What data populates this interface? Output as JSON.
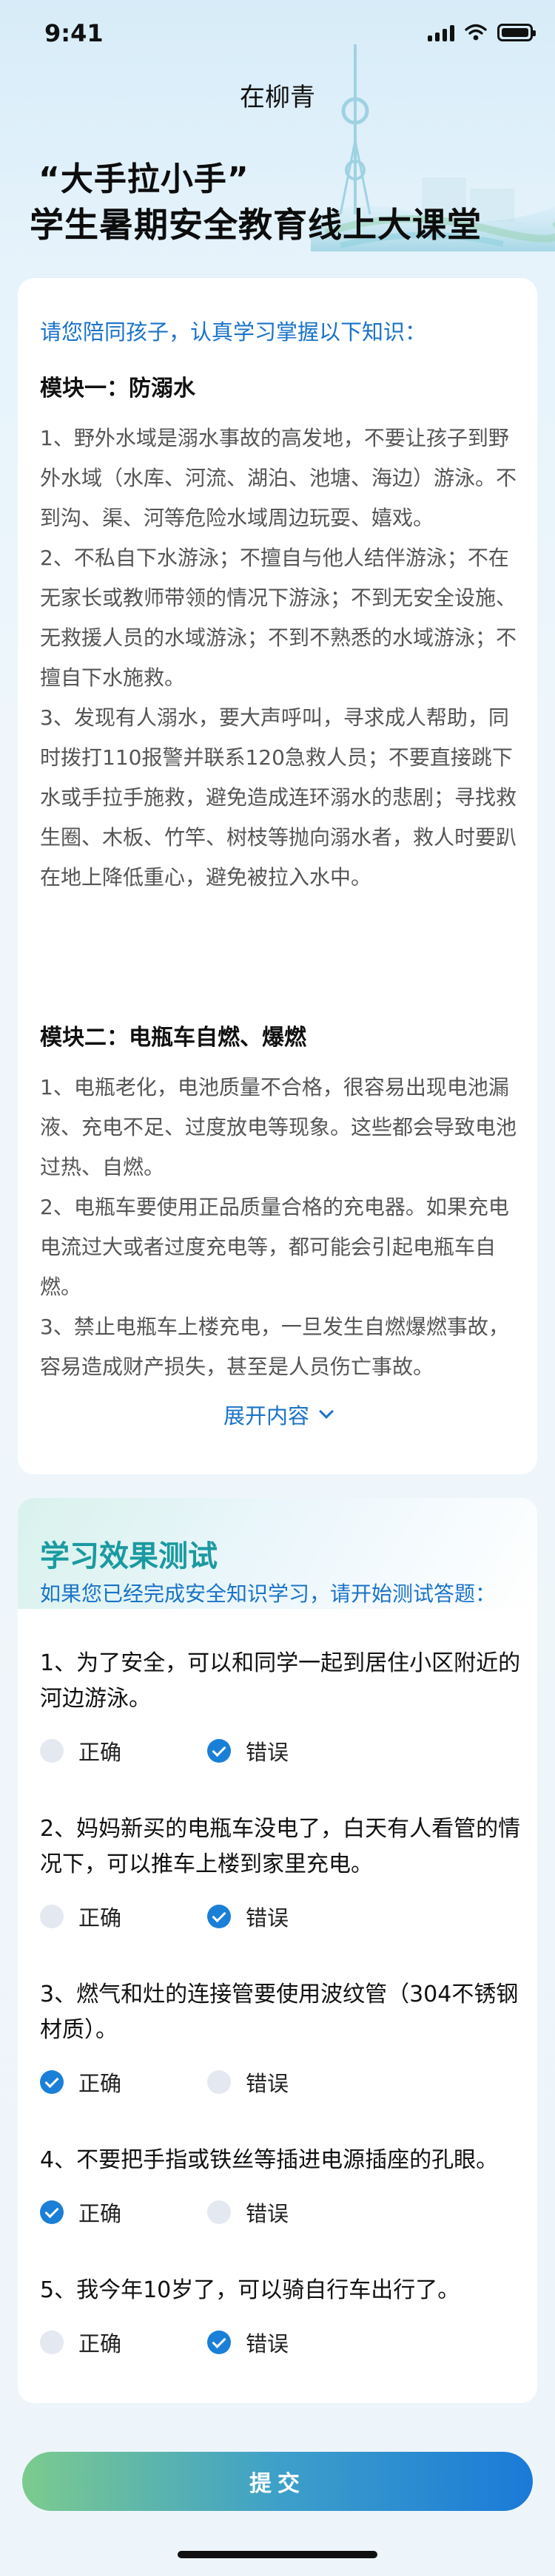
{
  "status_bar": {
    "time": "9:41"
  },
  "nav": {
    "title": "在柳青"
  },
  "hero": {
    "line1": "“大手拉小手”",
    "line2": "学生暑期安全教育线上大课堂"
  },
  "knowledge": {
    "intro": "请您陪同孩子，认真学习掌握以下知识：",
    "modules": [
      {
        "title": "模块一：防溺水",
        "paragraphs": [
          "1、野外水域是溺水事故的高发地，不要让孩子到野外水域（水库、河流、湖泊、池塘、海边）游泳。不到沟、渠、河等危险水域周边玩耍、嬉戏。",
          "2、不私自下水游泳；不擅自与他人结伴游泳；不在无家长或教师带领的情况下游泳；不到无安全设施、无救援人员的水域游泳；不到不熟悉的水域游泳；不擅自下水施救。",
          "3、发现有人溺水，要大声呼叫，寻求成人帮助，同时拨打110报警并联系120急救人员；不要直接跳下水或手拉手施救，避免造成连环溺水的悲剧；寻找救生圈、木板、竹竿、树枝等抛向溺水者，救人时要趴在地上降低重心，避免被拉入水中。"
        ]
      },
      {
        "title": "模块二：电瓶车自燃、爆燃",
        "paragraphs": [
          "1、电瓶老化，电池质量不合格，很容易出现电池漏液、充电不足、过度放电等现象。这些都会导致电池过热、自燃。",
          "2、电瓶车要使用正品质量合格的充电器。如果充电电流过大或者过度充电等，都可能会引起电瓶车自燃。",
          "3、禁止电瓶车上楼充电，一旦发生自燃爆燃事故，容易造成财产损失，甚至是人员伤亡事故。"
        ]
      }
    ],
    "expand_label": "展开内容"
  },
  "quiz": {
    "title": "学习效果测试",
    "subtitle": "如果您已经完成安全知识学习，请开始测试答题：",
    "option_labels": [
      "正确",
      "错误"
    ],
    "questions": [
      {
        "text": "1、为了安全，可以和同学一起到居住小区附近的河边游泳。",
        "selected": "错误"
      },
      {
        "text": "2、妈妈新买的电瓶车没电了，白天有人看管的情况下，可以推车上楼到家里充电。",
        "selected": "错误"
      },
      {
        "text": "3、燃气和灶的连接管要使用波纹管（304不锈钢材质）。",
        "selected": "正确"
      },
      {
        "text": "4、不要把手指或铁丝等插进电源插座的孔眼。",
        "selected": "正确"
      },
      {
        "text": "5、我今年10岁了，可以骑自行车出行了。",
        "selected": "错误"
      }
    ]
  },
  "submit_label": "提交",
  "colors": {
    "accent": "#1a73c8",
    "teal": "#1a9aa0",
    "radio_on": "#1a7fd6"
  }
}
